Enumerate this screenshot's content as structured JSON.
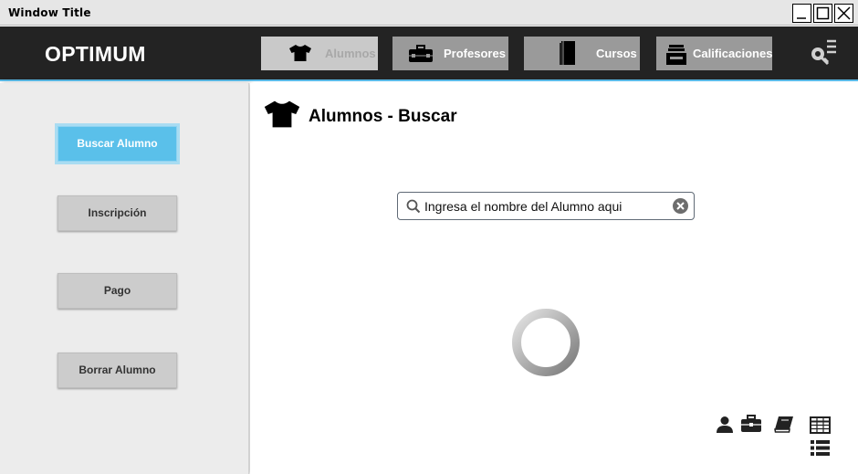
{
  "window": {
    "title": "Window Title"
  },
  "header": {
    "logo": "OPTIMUM",
    "nav": [
      {
        "label": "Alumnos",
        "icon": "tshirt-icon",
        "active": true
      },
      {
        "label": "Profesores",
        "icon": "briefcase-icon",
        "active": false
      },
      {
        "label": "Cursos",
        "icon": "book-icon",
        "active": false
      },
      {
        "label": "Calificaciones",
        "icon": "inbox-tray-icon",
        "active": false
      }
    ],
    "settings_icon": "key-menu-icon"
  },
  "sidebar": {
    "items": [
      {
        "label": "Buscar Alumno",
        "active": true
      },
      {
        "label": "Inscripción",
        "active": false
      },
      {
        "label": "Pago",
        "active": false
      },
      {
        "label": "Borrar Alumno",
        "active": false
      }
    ]
  },
  "main": {
    "title": "Alumnos - Buscar",
    "title_icon": "tshirt-icon",
    "search": {
      "placeholder": "Ingresa el nombre del Alumno aqui",
      "value": ""
    },
    "bottom_icons": [
      "user-icon",
      "briefcase-icon",
      "book-icon",
      "table-icon",
      "list-icon"
    ]
  },
  "colors": {
    "header_bg": "#232323",
    "accent": "#5ac0ea",
    "nav_button": "#9a9a9a",
    "nav_active": "#c9c9c9",
    "sidebar_bg": "#ececec"
  }
}
